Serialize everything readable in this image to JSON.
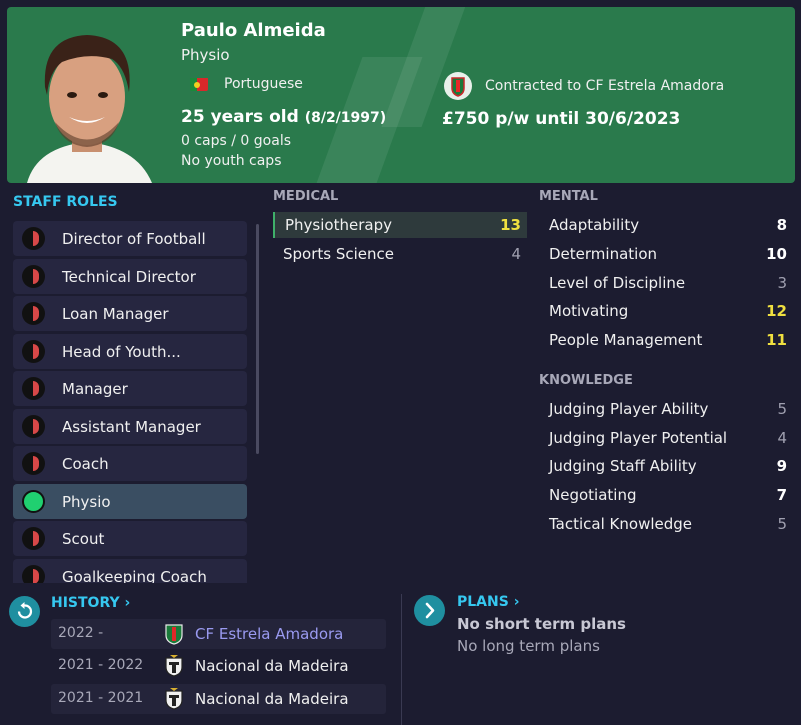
{
  "person": {
    "name": "Paulo Almeida",
    "role": "Physio",
    "nationality": "Portuguese",
    "age": "25 years old",
    "dob": "(8/2/1997)",
    "caps": "0 caps / 0 goals",
    "youth_caps": "No youth caps",
    "contract": "Contracted to CF Estrela Amadora",
    "wage": "£750 p/w until 30/6/2023"
  },
  "staff_roles": {
    "title": "STAFF ROLES",
    "items": [
      {
        "label": "Director of Football",
        "active": false
      },
      {
        "label": "Technical Director",
        "active": false
      },
      {
        "label": "Loan Manager",
        "active": false
      },
      {
        "label": "Head of Youth...",
        "active": false
      },
      {
        "label": "Manager",
        "active": false
      },
      {
        "label": "Assistant Manager",
        "active": false
      },
      {
        "label": "Coach",
        "active": false
      },
      {
        "label": "Physio",
        "active": true
      },
      {
        "label": "Scout",
        "active": false
      },
      {
        "label": "Goalkeeping Coach",
        "active": false
      }
    ]
  },
  "medical": {
    "title": "MEDICAL",
    "attributes": [
      {
        "label": "Physiotherapy",
        "value": "13"
      },
      {
        "label": "Sports Science",
        "value": "4"
      }
    ]
  },
  "mental": {
    "title": "MENTAL",
    "attributes": [
      {
        "label": "Adaptability",
        "value": "8"
      },
      {
        "label": "Determination",
        "value": "10"
      },
      {
        "label": "Level of Discipline",
        "value": "3"
      },
      {
        "label": "Motivating",
        "value": "12"
      },
      {
        "label": "People Management",
        "value": "11"
      }
    ]
  },
  "knowledge": {
    "title": "KNOWLEDGE",
    "attributes": [
      {
        "label": "Judging Player Ability",
        "value": "5"
      },
      {
        "label": "Judging Player Potential",
        "value": "4"
      },
      {
        "label": "Judging Staff Ability",
        "value": "9"
      },
      {
        "label": "Negotiating",
        "value": "7"
      },
      {
        "label": "Tactical Knowledge",
        "value": "5"
      }
    ]
  },
  "history": {
    "title": "HISTORY",
    "chevron": "›",
    "rows": [
      {
        "years": "2022 -",
        "club": "CF Estrela Amadora"
      },
      {
        "years": "2021 - 2022",
        "club": "Nacional da Madeira"
      },
      {
        "years": "2021 - 2021",
        "club": "Nacional da Madeira"
      }
    ]
  },
  "plans": {
    "title": "PLANS",
    "chevron": "›",
    "short_term": "No short term plans",
    "long_term": "No long term plans"
  },
  "colors": {
    "header_bg": "#2a7a4c",
    "accent_cyan": "#36c8f0",
    "value_yellow": "#f0e040",
    "active_role": "#20d070"
  }
}
